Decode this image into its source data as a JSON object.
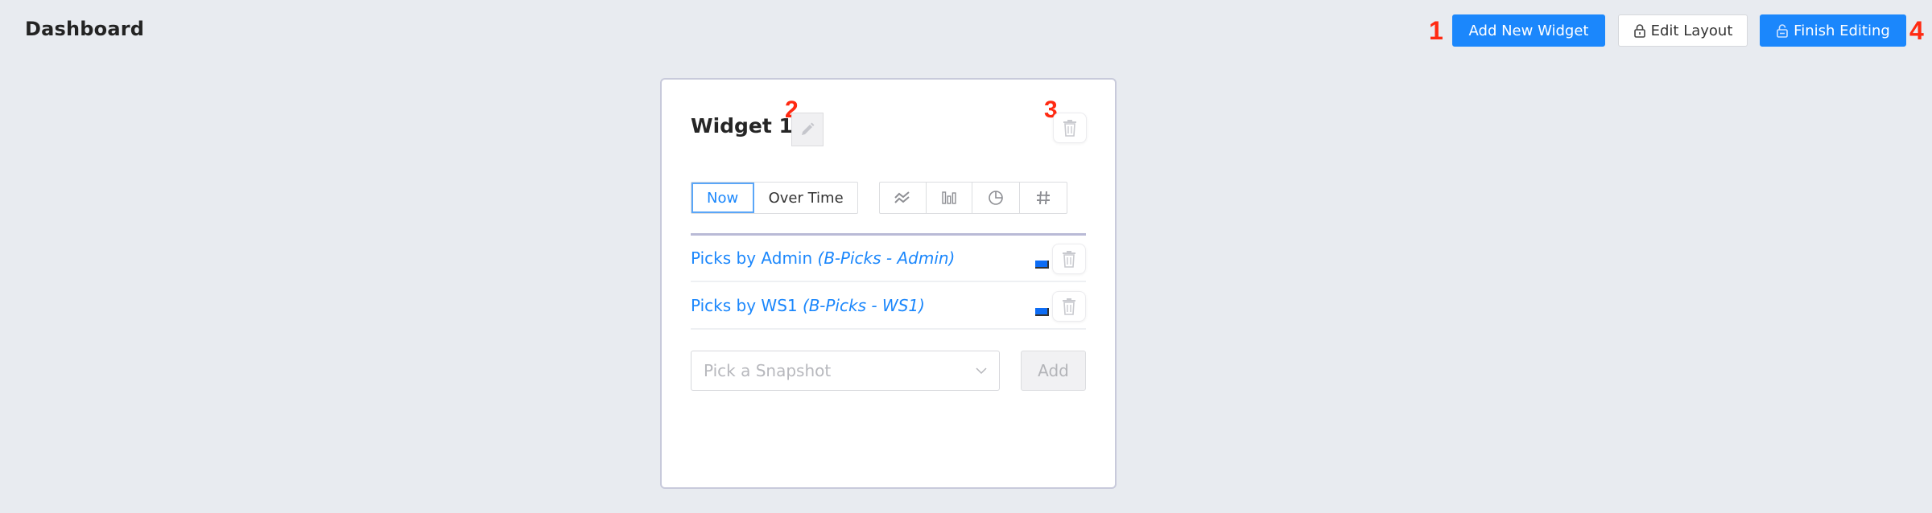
{
  "header": {
    "title": "Dashboard",
    "buttons": {
      "add_widget": "Add New Widget",
      "edit_layout": "Edit Layout",
      "finish_editing": "Finish Editing"
    }
  },
  "annotations": {
    "m1": "1",
    "m2": "2",
    "m3": "3",
    "m4": "4"
  },
  "widget": {
    "title": "Widget 1",
    "time_modes": [
      {
        "label": "Now",
        "active": true
      },
      {
        "label": "Over Time",
        "active": false
      }
    ],
    "chart_types": [
      {
        "icon": "line-chart-icon"
      },
      {
        "icon": "bar-chart-icon"
      },
      {
        "icon": "pie-chart-icon"
      },
      {
        "icon": "number-icon"
      }
    ],
    "series": [
      {
        "name": "Picks by Admin",
        "source": "(B-Picks - Admin)",
        "color": "#0d6cf4"
      },
      {
        "name": "Picks by WS1",
        "source": "(B-Picks - WS1)",
        "color": "#0d6cf4"
      }
    ],
    "snapshot_select": {
      "placeholder": "Pick a Snapshot"
    },
    "add_label": "Add"
  },
  "colors": {
    "accent": "#1b87fc",
    "marker": "#ff2a12",
    "background": "#e8ebf0"
  }
}
